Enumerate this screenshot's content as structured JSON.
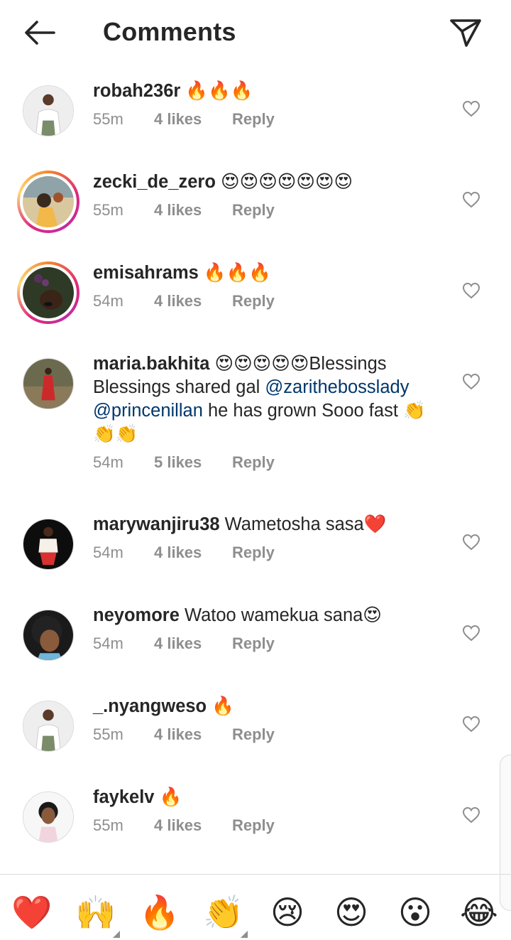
{
  "header": {
    "title": "Comments"
  },
  "comments": [
    {
      "username": "robah236r",
      "text": " 🔥🔥🔥",
      "time": "55m",
      "likes": "4 likes",
      "reply": "Reply"
    },
    {
      "username": "zecki_de_zero",
      "text": " 😍😍😍😍😍😍😍",
      "time": "55m",
      "likes": "4 likes",
      "reply": "Reply"
    },
    {
      "username": "emisahrams",
      "text": " 🔥🔥🔥",
      "time": "54m",
      "likes": "4 likes",
      "reply": "Reply"
    },
    {
      "username": "maria.bakhita",
      "text_a": " 😍😍😍😍😍Blessings Blessings shared gal ",
      "mention1": "@zarithebosslady",
      "mention2": "@princenillan",
      "text_b": " he has grown Sooo fast 👏👏👏",
      "time": "54m",
      "likes": "5 likes",
      "reply": "Reply"
    },
    {
      "username": "marywanjiru38",
      "text": " Wametosha sasa❤️",
      "time": "54m",
      "likes": "4 likes",
      "reply": "Reply"
    },
    {
      "username": "neyomore",
      "text": " Watoo wamekua sana😍",
      "time": "54m",
      "likes": "4 likes",
      "reply": "Reply"
    },
    {
      "username": "_.nyangweso",
      "text": " 🔥",
      "time": "55m",
      "likes": "4 likes",
      "reply": "Reply"
    },
    {
      "username": "faykelv",
      "text": " 🔥",
      "time": "55m",
      "likes": "4 likes",
      "reply": "Reply"
    }
  ],
  "reactions": [
    "❤️",
    "🙌",
    "🔥",
    "👏",
    "😢",
    "😍",
    "😮",
    "😂"
  ]
}
